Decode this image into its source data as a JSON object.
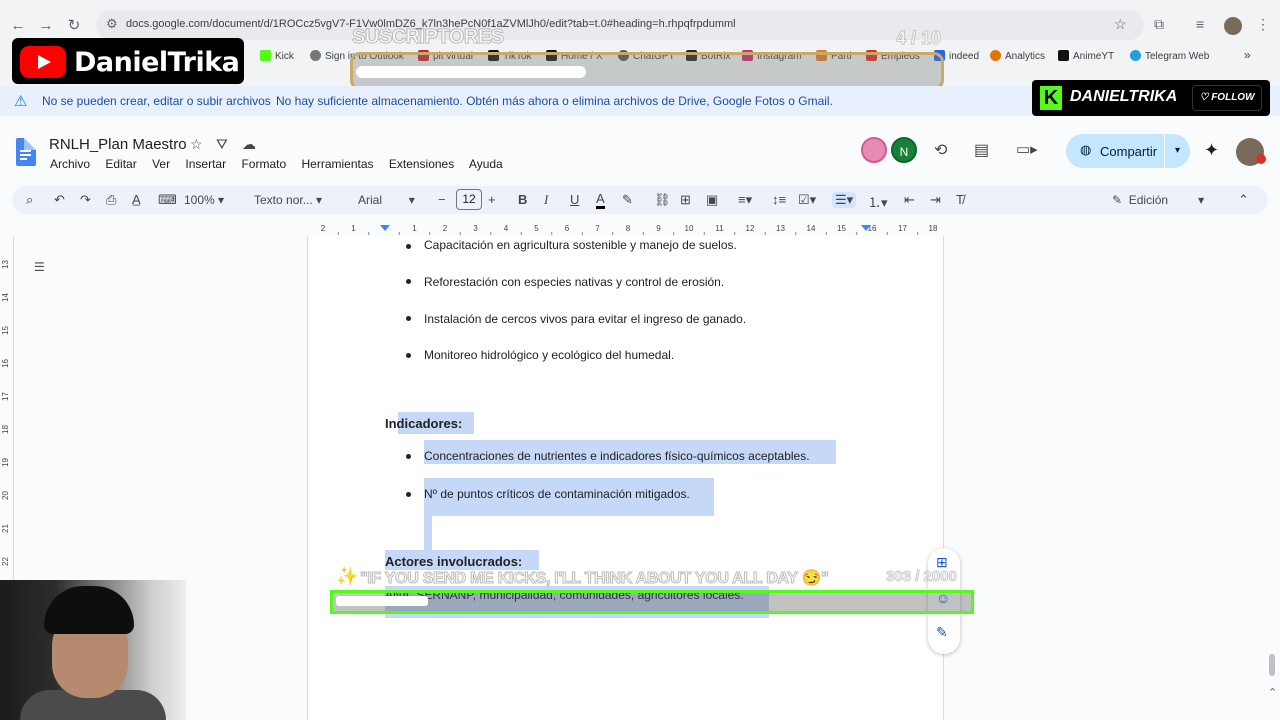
{
  "browser": {
    "url": "docs.google.com/document/d/1ROCcz5vgV7-F1Vw0lmDZ6_k7ln3hePcN0f1aZVMlJh0/edit?tab=t.0#heading=h.rhpqfrpdumml",
    "bookmarks": [
      "Kick",
      "Sign in to Outlook",
      "plt virtual",
      "TikTok",
      "Home / X",
      "ChatGPT",
      "BotRix",
      "Instagram",
      "Parti",
      "Empleos",
      "indeed",
      "Analytics",
      "AnimeYT",
      "Telegram Web"
    ]
  },
  "overlay": {
    "channel_name": "DanielTrika",
    "subs_label": "SUSCRIPTORES",
    "subs_count": "4 / 10",
    "kick_name": "DANIELTRIKA",
    "kick_follow": "FOLLOW",
    "chat_message": "\"IF YOU SEND ME KICKS, I'LL THINK ABOUT YOU ALL DAY 😏\"",
    "chat_count": "303 / 2000"
  },
  "warning": {
    "title": "No se pueden crear, editar o subir archivos",
    "message": "No hay suficiente almacenamiento. Obtén más ahora o elimina archivos de Drive, Google Fotos o Gmail."
  },
  "docs": {
    "title": "RNLH_Plan Maestro",
    "menu": [
      "Archivo",
      "Editar",
      "Ver",
      "Insertar",
      "Formato",
      "Herramientas",
      "Extensiones",
      "Ayuda"
    ],
    "avatar_letter": "N",
    "share_label": "Compartir",
    "toolbar": {
      "zoom": "100%",
      "style": "Texto nor...",
      "font": "Arial",
      "font_size": "12",
      "mode": "Edición"
    },
    "ruler_numbers": [
      "2",
      "1",
      "",
      "1",
      "2",
      "3",
      "4",
      "5",
      "6",
      "7",
      "8",
      "9",
      "10",
      "11",
      "12",
      "13",
      "14",
      "15",
      "16",
      "17",
      "18"
    ],
    "left_ruler_numbers": [
      "13",
      "14",
      "15",
      "16",
      "17",
      "18",
      "19",
      "20",
      "21",
      "22"
    ]
  },
  "document": {
    "bullets_top": [
      "Capacitación en agricultura sostenible y manejo de suelos.",
      "Reforestación con especies nativas y control de erosión.",
      "Instalación de cercos vivos para evitar el ingreso de ganado.",
      "Monitoreo hidrológico y ecológico del humedal."
    ],
    "heading_indicadores": "Indicadores:",
    "bullets_indicadores": [
      "Concentraciones de nutrientes e indicadores físico-químicos aceptables.",
      "Nº de puntos críticos de contaminación mitigados."
    ],
    "heading_actores": "Actores involucrados:",
    "actores_text": "ANA, SERNANP, municipalidad, comunidades, agricultores locales."
  },
  "colors": {
    "selection": "#c5d8f7",
    "share_bg": "#c2e7ff",
    "kick_green": "#53fc18",
    "youtube_red": "#ff0000"
  }
}
